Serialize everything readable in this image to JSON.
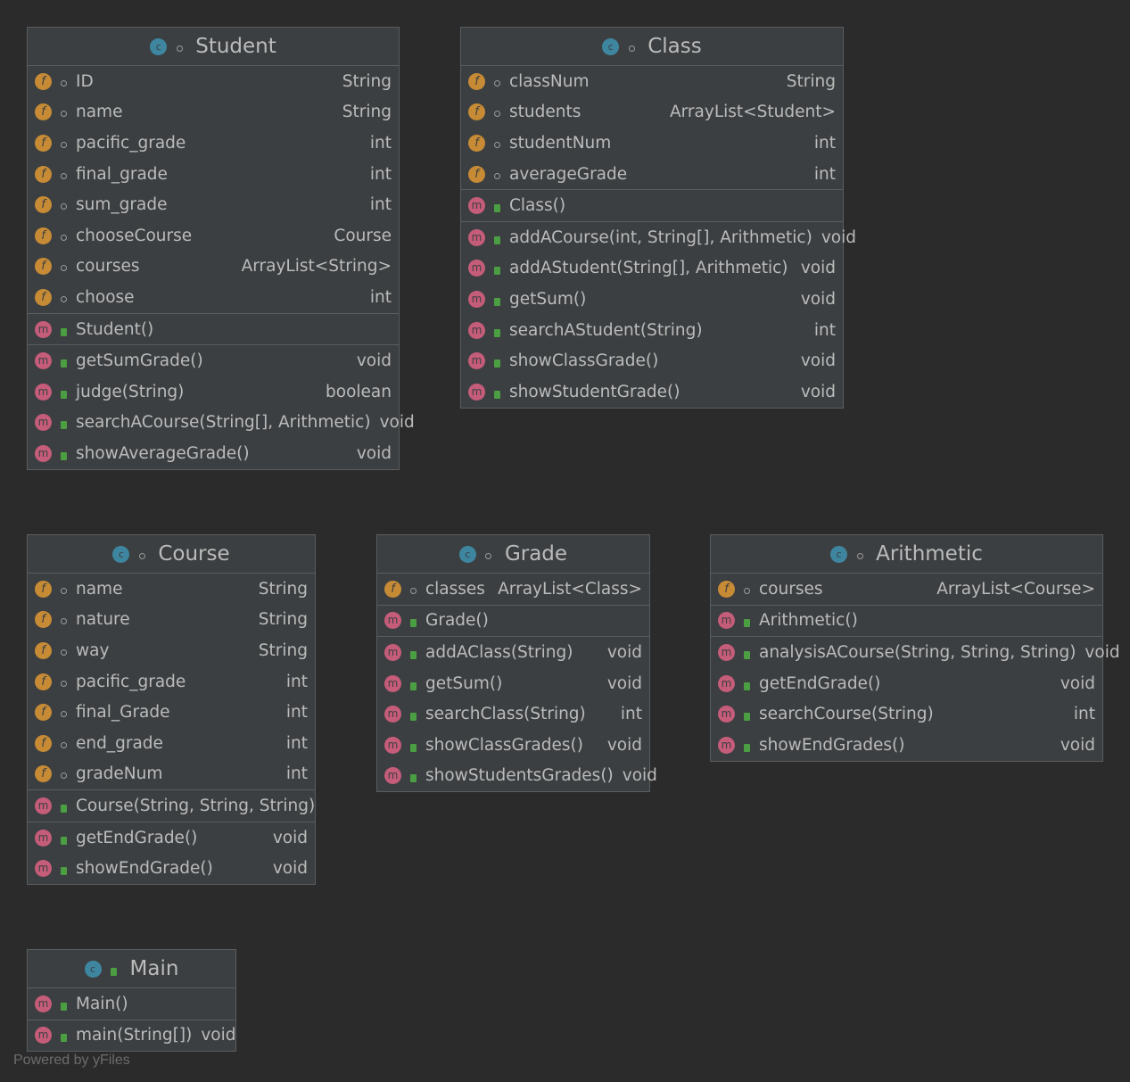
{
  "classes": [
    {
      "name": "Student",
      "icon": "class-icon",
      "header_visibility": "package",
      "fields": [
        {
          "name": "ID",
          "type": "String"
        },
        {
          "name": "name",
          "type": "String"
        },
        {
          "name": "pacific_grade",
          "type": "int"
        },
        {
          "name": "final_grade",
          "type": "int"
        },
        {
          "name": "sum_grade",
          "type": "int"
        },
        {
          "name": "chooseCourse",
          "type": "Course"
        },
        {
          "name": "courses",
          "type": "ArrayList<String>"
        },
        {
          "name": "choose",
          "type": "int"
        }
      ],
      "constructors": [
        {
          "name": "Student()",
          "type": ""
        }
      ],
      "methods": [
        {
          "name": "getSumGrade()",
          "type": "void"
        },
        {
          "name": "judge(String)",
          "type": "boolean"
        },
        {
          "name": "searchACourse(String[], Arithmetic)",
          "type": "void"
        },
        {
          "name": "showAverageGrade()",
          "type": "void"
        }
      ]
    },
    {
      "name": "Class",
      "icon": "class-icon",
      "header_visibility": "package",
      "fields": [
        {
          "name": "classNum",
          "type": "String"
        },
        {
          "name": "students",
          "type": "ArrayList<Student>"
        },
        {
          "name": "studentNum",
          "type": "int"
        },
        {
          "name": "averageGrade",
          "type": "int"
        }
      ],
      "constructors": [
        {
          "name": "Class()",
          "type": ""
        }
      ],
      "methods": [
        {
          "name": "addACourse(int, String[], Arithmetic)",
          "type": "void"
        },
        {
          "name": "addAStudent(String[], Arithmetic)",
          "type": "void"
        },
        {
          "name": "getSum()",
          "type": "void"
        },
        {
          "name": "searchAStudent(String)",
          "type": "int"
        },
        {
          "name": "showClassGrade()",
          "type": "void"
        },
        {
          "name": "showStudentGrade()",
          "type": "void"
        }
      ]
    },
    {
      "name": "Course",
      "icon": "class-icon",
      "header_visibility": "package",
      "fields": [
        {
          "name": "name",
          "type": "String"
        },
        {
          "name": "nature",
          "type": "String"
        },
        {
          "name": "way",
          "type": "String"
        },
        {
          "name": "pacific_grade",
          "type": "int"
        },
        {
          "name": "final_Grade",
          "type": "int"
        },
        {
          "name": "end_grade",
          "type": "int"
        },
        {
          "name": "gradeNum",
          "type": "int"
        }
      ],
      "constructors": [
        {
          "name": "Course(String, String, String)",
          "type": ""
        }
      ],
      "methods": [
        {
          "name": "getEndGrade()",
          "type": "void"
        },
        {
          "name": "showEndGrade()",
          "type": "void"
        }
      ]
    },
    {
      "name": "Grade",
      "icon": "class-icon",
      "header_visibility": "package",
      "fields": [
        {
          "name": "classes",
          "type": "ArrayList<Class>"
        }
      ],
      "constructors": [
        {
          "name": "Grade()",
          "type": ""
        }
      ],
      "methods": [
        {
          "name": "addAClass(String)",
          "type": "void"
        },
        {
          "name": "getSum()",
          "type": "void"
        },
        {
          "name": "searchClass(String)",
          "type": "int"
        },
        {
          "name": "showClassGrades()",
          "type": "void"
        },
        {
          "name": "showStudentsGrades()",
          "type": "void"
        }
      ]
    },
    {
      "name": "Arithmetic",
      "icon": "class-icon",
      "header_visibility": "package",
      "fields": [
        {
          "name": "courses",
          "type": "ArrayList<Course>"
        }
      ],
      "constructors": [
        {
          "name": "Arithmetic()",
          "type": ""
        }
      ],
      "methods": [
        {
          "name": "analysisACourse(String, String, String)",
          "type": "void"
        },
        {
          "name": "getEndGrade()",
          "type": "void"
        },
        {
          "name": "searchCourse(String)",
          "type": "int"
        },
        {
          "name": "showEndGrades()",
          "type": "void"
        }
      ]
    },
    {
      "name": "Main",
      "icon": "runnable-class-icon",
      "header_visibility": "public",
      "fields": [],
      "constructors": [
        {
          "name": "Main()",
          "type": ""
        }
      ],
      "methods": [
        {
          "name": "main(String[])",
          "type": "void"
        }
      ]
    }
  ],
  "icons": {
    "field_letter": "f",
    "method_letter": "m",
    "class_letter": "c"
  },
  "colors": {
    "background": "#2b2b2b",
    "node_fill": "#3c3f41",
    "node_border": "#5a5d5f",
    "text": "#bbbbbb",
    "field_icon": "#c78b35",
    "method_icon": "#c55c7a",
    "class_icon": "#3e86a0",
    "public_lock": "#4b9e41"
  },
  "watermark": "Powered by yFiles"
}
